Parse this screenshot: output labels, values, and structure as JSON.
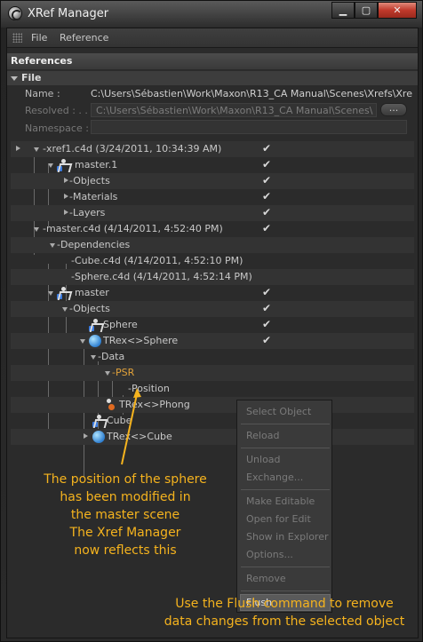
{
  "window": {
    "title": "XRef Manager"
  },
  "menu": {
    "items": [
      "File",
      "Reference"
    ]
  },
  "references": {
    "header": "References",
    "file_section": "File",
    "name_label": "Name :",
    "name_value": "C:\\Users\\Sébastien\\Work\\Maxon\\R13_CA Manual\\Scenes\\Xrefs\\Xref_e",
    "resolved_label": "Resolved : . .",
    "resolved_value": "C:\\Users\\Sébastien\\Work\\Maxon\\R13_CA Manual\\Scenes\\Xre",
    "browse_label": "...",
    "namespace_label": "Namespace :",
    "namespace_value": ""
  },
  "tree": {
    "rows": [
      {
        "label": "xref1.c4d (3/24/2011, 10:34:39 AM)",
        "checked": true
      },
      {
        "label": "master.1",
        "checked": true
      },
      {
        "label": "Objects",
        "checked": true
      },
      {
        "label": "Materials",
        "checked": true
      },
      {
        "label": "Layers",
        "checked": true
      },
      {
        "label": "master.c4d (4/14/2011, 4:52:40 PM)",
        "checked": true
      },
      {
        "label": "Dependencies",
        "checked": false
      },
      {
        "label": "Cube.c4d (4/14/2011, 4:52:10 PM)",
        "checked": false
      },
      {
        "label": "Sphere.c4d (4/14/2011, 4:52:14 PM)",
        "checked": false
      },
      {
        "label": "master",
        "checked": true
      },
      {
        "label": "Objects",
        "checked": true
      },
      {
        "label": "Sphere",
        "checked": true
      },
      {
        "label": "TRex<>Sphere",
        "checked": true
      },
      {
        "label": "Data",
        "checked": false
      },
      {
        "label": "PSR",
        "checked": false
      },
      {
        "label": "Position",
        "checked": false
      },
      {
        "label": "TRex<>Phong",
        "checked": false
      },
      {
        "label": "Cube",
        "checked": false
      },
      {
        "label": "TRex<>Cube",
        "checked": false
      }
    ],
    "check_glyph": "✔"
  },
  "context_menu": {
    "items": [
      "Select Object",
      "Reload",
      "Unload",
      "Exchange...",
      "Make Editable",
      "Open for Edit",
      "Show in Explorer",
      "Options...",
      "Remove",
      "Flush"
    ]
  },
  "annotations": {
    "left": [
      "The position of the sphere",
      "has been modified in",
      "the master scene",
      "The Xref Manager",
      "now reflects this"
    ],
    "bottom": [
      "Use the Flush command to remove",
      "data changes from the selected object"
    ]
  },
  "colors": {
    "annotation": "#f5b31e",
    "highlight_text": "#e2a23a"
  }
}
